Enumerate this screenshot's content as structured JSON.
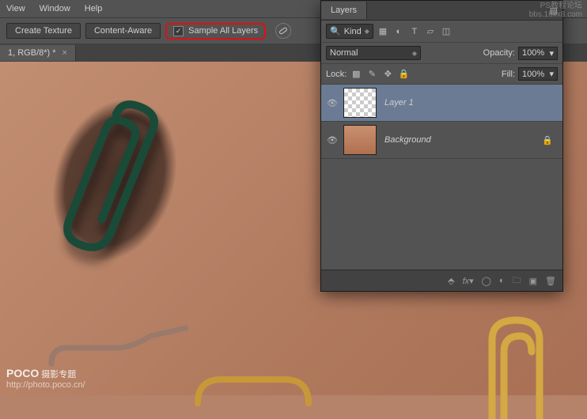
{
  "menu": {
    "view": "View",
    "window": "Window",
    "help": "Help"
  },
  "opt": {
    "createTexture": "Create Texture",
    "contentAware": "Content-Aware",
    "sampleAll": "Sample All Layers"
  },
  "tab": {
    "name": "1, RGB/8*) *"
  },
  "panel": {
    "title": "Layers",
    "kind": "Kind",
    "blend": "Normal",
    "opacityLbl": "Opacity:",
    "opacityVal": "100%",
    "lockLbl": "Lock:",
    "fillLbl": "Fill:",
    "fillVal": "100%",
    "layer1": "Layer 1",
    "bg": "Background"
  },
  "watermark": {
    "top1": "PS教程论坛",
    "top2": "bbs.16xx8.com",
    "bl1": "POCO",
    "bl2": "摄影专题",
    "bl3": "http://photo.poco.cn/"
  }
}
